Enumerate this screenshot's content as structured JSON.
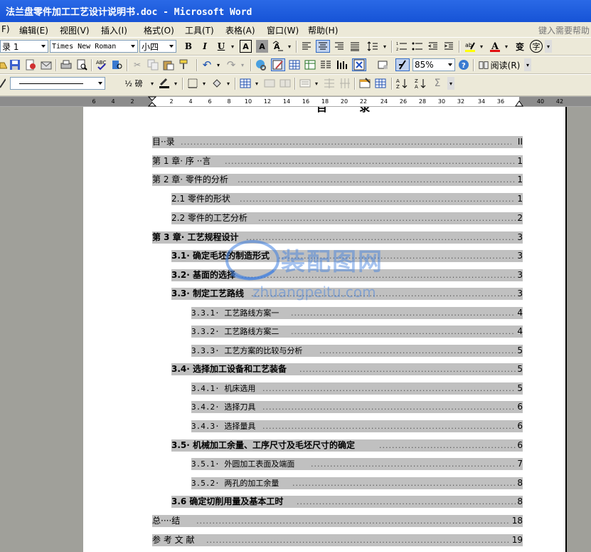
{
  "window": {
    "title": "法兰盘零件加工工艺设计说明书.doc - Microsoft Word"
  },
  "menu": {
    "items": [
      "F)",
      "编辑(E)",
      "视图(V)",
      "插入(I)",
      "格式(O)",
      "工具(T)",
      "表格(A)",
      "窗口(W)",
      "帮助(H)"
    ],
    "help_placeholder": "键入需要帮助"
  },
  "toolbar1": {
    "style": "录 1",
    "font": "Times New Roman",
    "size": "小四",
    "bold": "B",
    "italic": "I",
    "underline": "U",
    "char_border": "A",
    "char_shade": "A",
    "font_color": "A",
    "pinyin": "变",
    "enclose": "字"
  },
  "toolbar2": {
    "zoom": "85%",
    "read_label": "阅读(R)"
  },
  "toolbar3": {
    "line_weight": "½ 磅"
  },
  "ruler": {
    "ticks": [
      "6",
      "4",
      "2",
      "2",
      "4",
      "6",
      "8",
      "10",
      "12",
      "14",
      "16",
      "18",
      "20",
      "22",
      "24",
      "26",
      "28",
      "30",
      "32",
      "34",
      "36",
      "40",
      "42"
    ]
  },
  "document": {
    "heading": "目 录",
    "toc": [
      {
        "label": "目··录",
        "page": "II"
      },
      {
        "label": "第 1 章· 序 ··言",
        "page": "1"
      },
      {
        "label": "第 2 章· 零件的分析",
        "page": "1"
      },
      {
        "label": "2.1 零件的形状",
        "page": "1"
      },
      {
        "label": "2.2 零件的工艺分析",
        "page": "2"
      },
      {
        "label": "第 3 章· 工艺规程设计",
        "page": "3"
      },
      {
        "label": "3.1· 确定毛坯的制造形式",
        "page": "3"
      },
      {
        "label": "3.2· 基面的选择",
        "page": "3"
      },
      {
        "label": "3.3· 制定工艺路线",
        "page": "3"
      },
      {
        "label": "3.3.1· 工艺路线方案一",
        "page": "4"
      },
      {
        "label": "3.3.2· 工艺路线方案二",
        "page": "4"
      },
      {
        "label": "3.3.3· 工艺方案的比较与分析",
        "page": "5"
      },
      {
        "label": "3.4· 选择加工设备和工艺装备",
        "page": "5"
      },
      {
        "label": "3.4.1· 机床选用",
        "page": "5"
      },
      {
        "label": "3.4.2· 选择刀具",
        "page": "6"
      },
      {
        "label": "3.4.3· 选择量具",
        "page": "6"
      },
      {
        "label": "3.5· 机械加工余量、工序尺寸及毛坯尺寸的确定",
        "page": "6"
      },
      {
        "label": "3.5.1· 外圆加工表面及端面",
        "page": "7"
      },
      {
        "label": "3.5.2· 两孔的加工余量",
        "page": "8"
      },
      {
        "label": "3.6 确定切削用量及基本工时",
        "page": "8"
      },
      {
        "label": "总····结",
        "page": "18"
      },
      {
        "label": "参 考 文 献",
        "page": "19"
      }
    ]
  },
  "watermark": {
    "text": "装配图网",
    "url": "zhuangpeitu.com"
  }
}
